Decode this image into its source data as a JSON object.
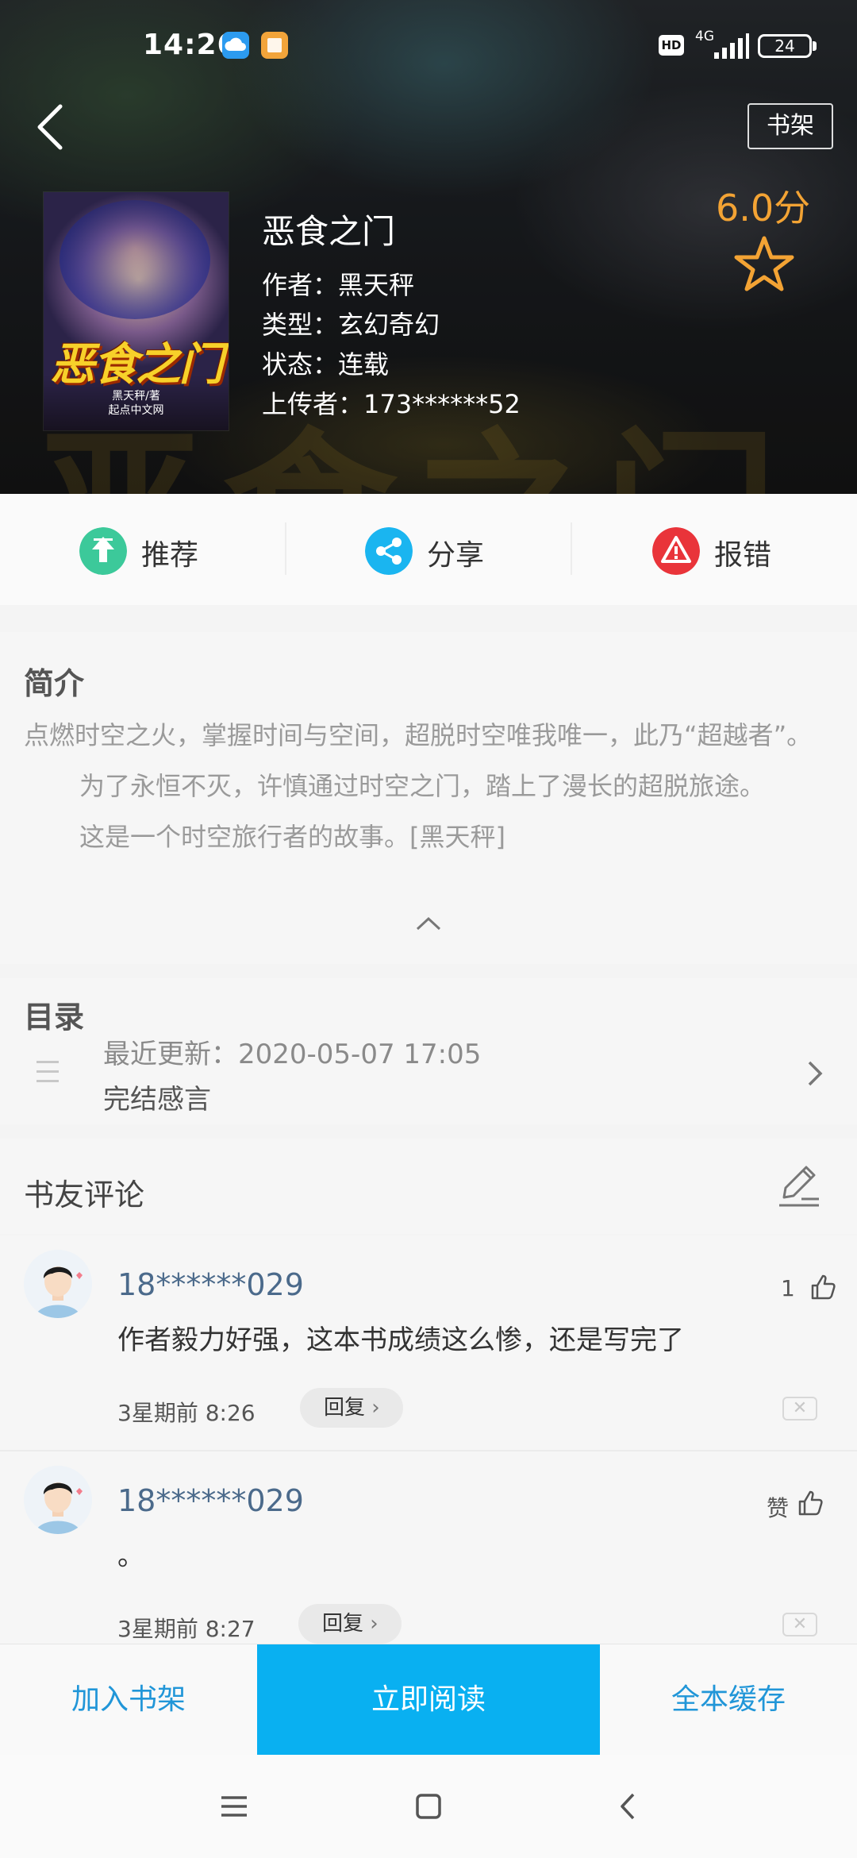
{
  "status_bar": {
    "time": "14:26",
    "hd": "HD",
    "network": "4G",
    "battery": "24"
  },
  "header": {
    "shelf_label": "书架"
  },
  "book": {
    "cover_title": "恶食之门",
    "cover_byline": "黑天秤/著",
    "cover_publisher": "起点中文网",
    "title": "恶食之门",
    "author": "作者：黑天秤",
    "genre": "类型：玄幻奇幻",
    "status": "状态：连载",
    "uploader": "上传者：173******52",
    "score": "6.0分"
  },
  "actions": {
    "recommend": "推荐",
    "share": "分享",
    "report": "报错"
  },
  "intro": {
    "title": "简介",
    "p1": "点燃时空之火，掌握时间与空间，超脱时空唯我唯一，此乃“超越者”。",
    "p2": "为了永恒不灭，许慎通过时空之门，踏上了漫长的超脱旅途。",
    "p3": "这是一个时空旅行者的故事。[黑天秤]"
  },
  "toc": {
    "title": "目录",
    "update": "最近更新：2020-05-07 17:05",
    "latest": "完结感言"
  },
  "comments_section": {
    "title": "书友评论"
  },
  "comments": [
    {
      "user": "18******029",
      "text": "作者毅力好强，这本书成绩这么惨，还是写完了",
      "time": "3星期前   8:26",
      "reply": "回复",
      "likes": "1"
    },
    {
      "user": "18******029",
      "text": "。",
      "time": "3星期前   8:27",
      "reply": "回复",
      "likes": "赞"
    }
  ],
  "bottom_bar": {
    "add_shelf": "加入书架",
    "read_now": "立即阅读",
    "cache_all": "全本缓存"
  },
  "colors": {
    "accent": "#09b0f1",
    "score": "#f3a334",
    "username": "#4b6a8b"
  }
}
